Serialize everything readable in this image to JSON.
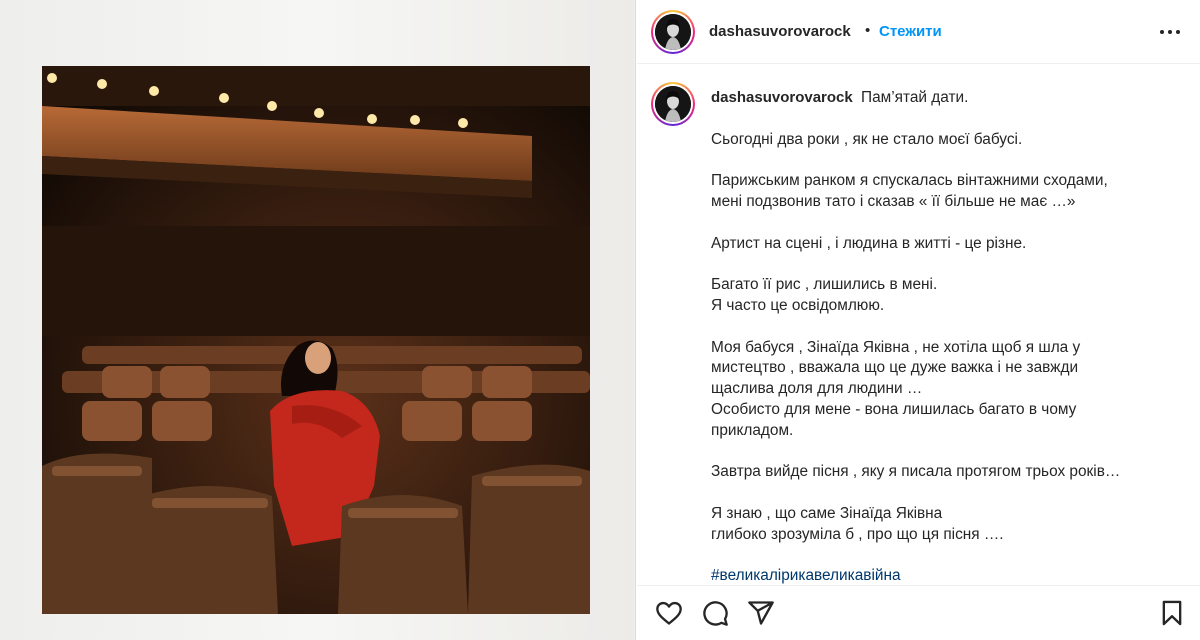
{
  "post": {
    "username": "dashasuvorovarock",
    "follow_label": "Стежити",
    "separator": "•",
    "caption_first_line": "Пам’ятай дати.",
    "caption_paragraphs": [
      [
        "Сьогодні два роки , як не стало моєї бабусі."
      ],
      [
        "Парижським ранком я спускалась вінтажними сходами,",
        "мені подзвонив тато і сказав « її більше не має …»"
      ],
      [
        "Артист на сцені , і людина в житті - це різне."
      ],
      [
        "Багато її рис , лишились в мені.",
        "Я часто це освідомлюю."
      ],
      [
        "Моя бабуся , Зінаїда Яківна , не хотіла щоб я шла у",
        "мистецтво , вважала що це дуже важка і не завжди",
        "щаслива доля для людини …",
        "Особисто для мене - вона лишилась багато в чому",
        "прикладом."
      ],
      [
        "Завтра вийде пісня , яку я писала протягом трьох років…"
      ],
      [
        "Я знаю , що саме Зінаїда Яківна",
        "глибоко зрозуміла б , про що ця пісня …."
      ]
    ],
    "hashtag": "#великалірикавеликавійна"
  },
  "icons": {
    "more": "more-horizontal-icon",
    "like": "heart-icon",
    "comment": "comment-icon",
    "share": "share-icon",
    "save": "bookmark-icon"
  },
  "colors": {
    "follow": "#0095f6",
    "hashtag": "#00376b",
    "text": "#262626",
    "accent_gradient": [
      "#f9ce34",
      "#ee2a7b",
      "#6228d7"
    ]
  }
}
